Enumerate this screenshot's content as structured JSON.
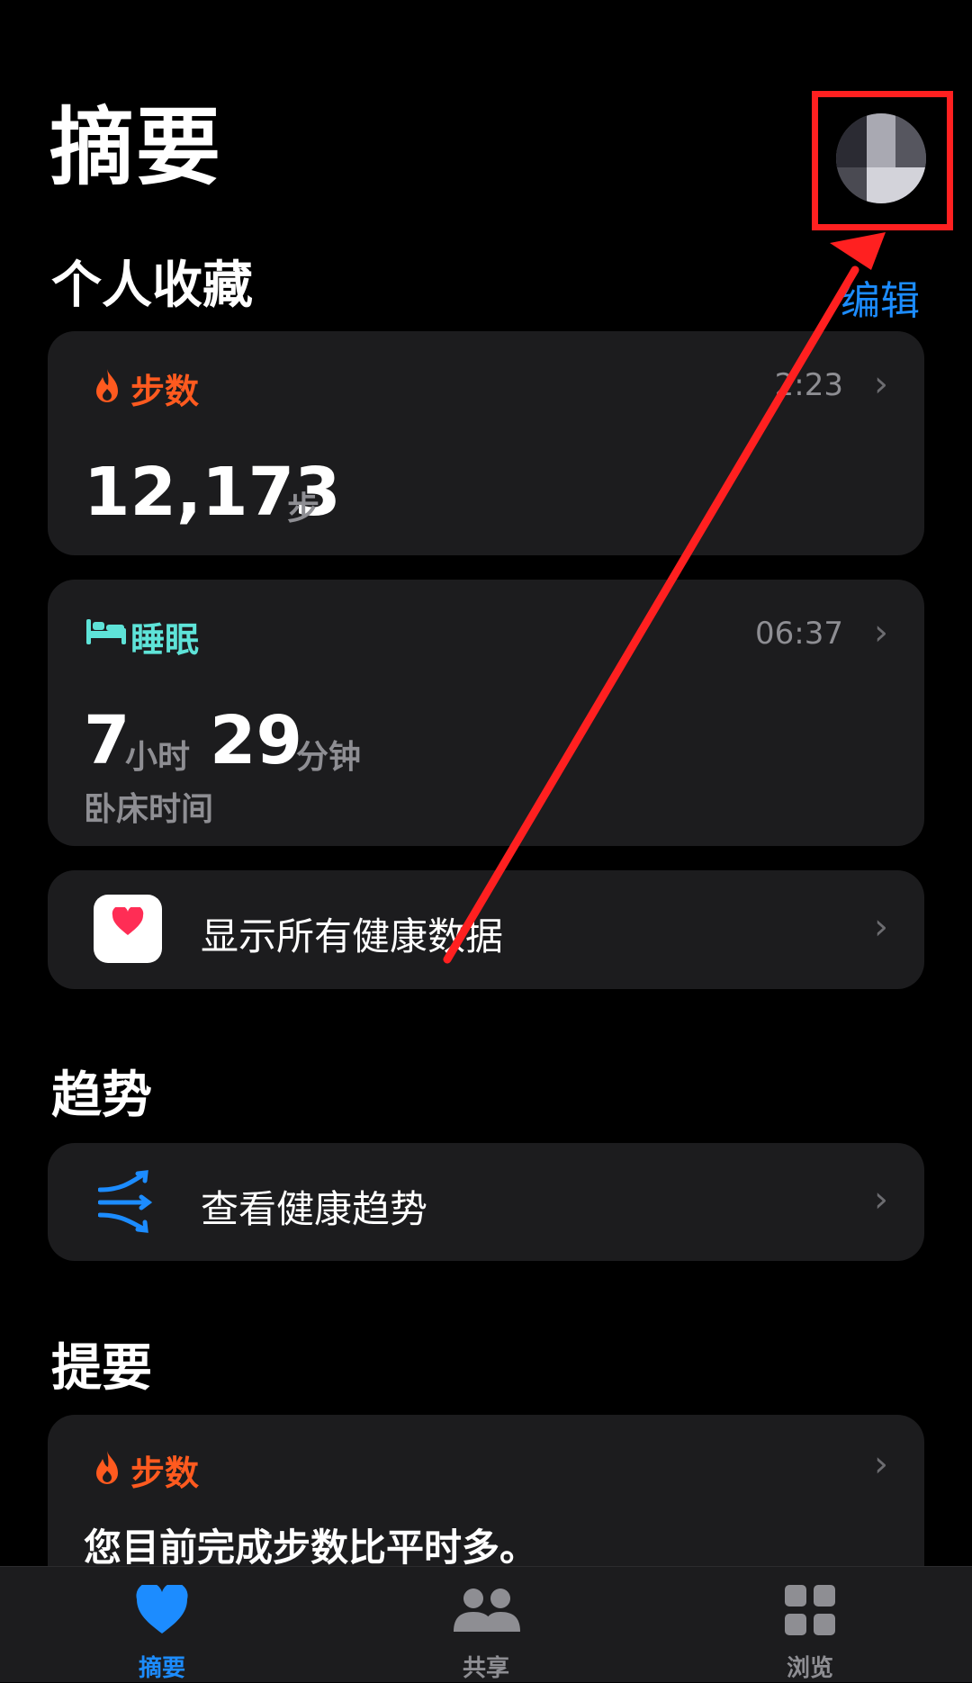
{
  "header": {
    "title": "摘要"
  },
  "favorites": {
    "title": "个人收藏",
    "edit_label": "编辑"
  },
  "steps_card": {
    "title": "步数",
    "time": "2:23",
    "value": "12,173",
    "unit": "步"
  },
  "sleep_card": {
    "title": "睡眠",
    "time": "06:37",
    "hours": "7",
    "hours_unit": "小时",
    "minutes": "29",
    "minutes_unit": "分钟",
    "subtitle": "卧床时间"
  },
  "all_data_row": {
    "label": "显示所有健康数据"
  },
  "trends": {
    "title": "趋势",
    "row_label": "查看健康趋势"
  },
  "highlights": {
    "title": "提要",
    "card_title": "步数",
    "text": "您目前完成步数比平时多。"
  },
  "tabbar": {
    "tabs": [
      {
        "label": "摘要"
      },
      {
        "label": "共享"
      },
      {
        "label": "浏览"
      }
    ]
  },
  "colors": {
    "steps": "#ff5a1f",
    "sleep": "#5ee3d8",
    "link": "#1c8cff",
    "active_tab": "#1c8cff",
    "annotation": "#ff2020"
  },
  "icons": {
    "steps": "flame-icon",
    "sleep": "bed-icon",
    "health_app": "heart-app-icon",
    "trends": "trend-arrows-icon",
    "chevron": "chevron-right-icon"
  }
}
